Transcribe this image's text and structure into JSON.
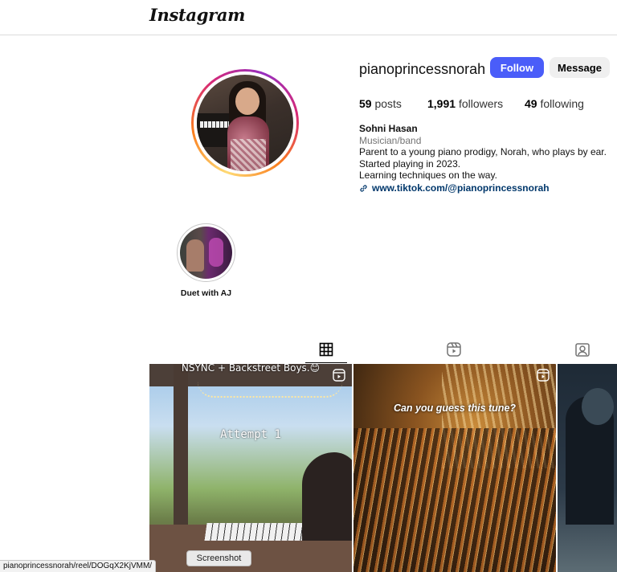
{
  "app": {
    "logo": "Instagram"
  },
  "profile": {
    "username": "pianoprincessnorah",
    "follow_label": "Follow",
    "message_label": "Message",
    "posts_count": "59",
    "posts_label": "posts",
    "followers_count": "1,991",
    "followers_label": "followers",
    "following_count": "49",
    "following_label": "following",
    "full_name": "Sohni Hasan",
    "category": "Musician/band",
    "bio_lines": [
      "Parent to a young piano prodigy, Norah, who plays by ear.",
      "Started playing in 2023.",
      "Learning techniques on the way."
    ],
    "link": "www.tiktok.com/@pianoprincessnorah"
  },
  "highlights": [
    {
      "label": "Duet with AJ"
    }
  ],
  "tabs": [
    {
      "icon": "grid-icon",
      "active": true
    },
    {
      "icon": "reels-icon",
      "active": false
    },
    {
      "icon": "tagged-icon",
      "active": false
    }
  ],
  "posts": [
    {
      "caption_top": "NSYNC + Backstreet Boys.😊",
      "overlay": "Attempt 1",
      "type": "reel"
    },
    {
      "caption": "Can you guess this tune?",
      "type": "reel"
    },
    {
      "type": "post"
    }
  ],
  "browser": {
    "status_url": "pianoprincessnorah/reel/DOGqX2KjVMM/",
    "tooltip": "Screenshot"
  },
  "colors": {
    "follow_button": "#4a5df9",
    "link": "#00376b",
    "muted": "#737373"
  }
}
